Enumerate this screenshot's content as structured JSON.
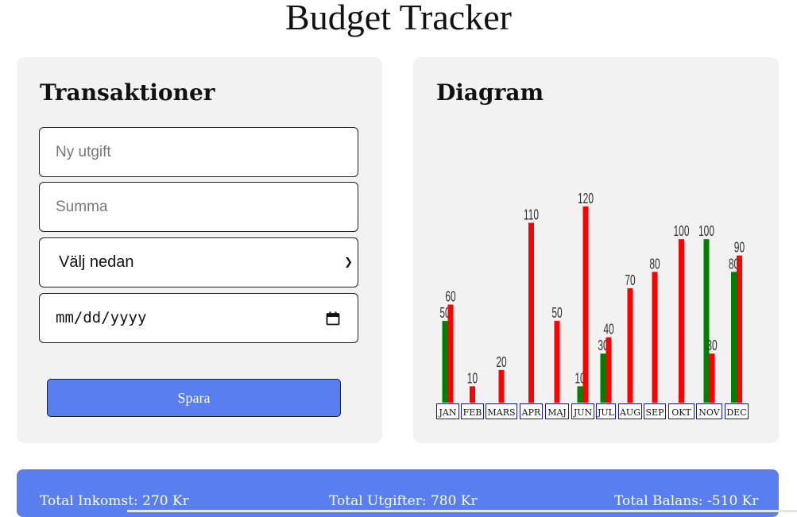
{
  "app": {
    "title": "Budget Tracker"
  },
  "transactions": {
    "title": "Transaktioner",
    "expense_placeholder": "Ny utgift",
    "amount_placeholder": "Summa",
    "select_value": "Välj nedan",
    "date_value": "mm/dd/yyyy",
    "save_label": "Spara"
  },
  "diagram": {
    "title": "Diagram"
  },
  "chart_data": {
    "type": "bar",
    "categories": [
      "JAN",
      "FEB",
      "MARS",
      "APR",
      "MAJ",
      "JUN",
      "JUL",
      "AUG",
      "SEP",
      "OKT",
      "NOV",
      "DEC"
    ],
    "series": [
      {
        "color": "#008000",
        "values": [
          50,
          null,
          null,
          null,
          null,
          10,
          30,
          null,
          null,
          null,
          100,
          80
        ]
      },
      {
        "color": "#ff0000",
        "values": [
          60,
          10,
          20,
          110,
          50,
          120,
          40,
          70,
          80,
          100,
          30,
          90
        ]
      }
    ],
    "ylim": [
      0,
      120
    ]
  },
  "totals": {
    "income": "Total Inkomst: 270 Kr",
    "expenses": "Total Utgifter: 780 Kr",
    "balance": "Total Balans: -510 Kr"
  }
}
